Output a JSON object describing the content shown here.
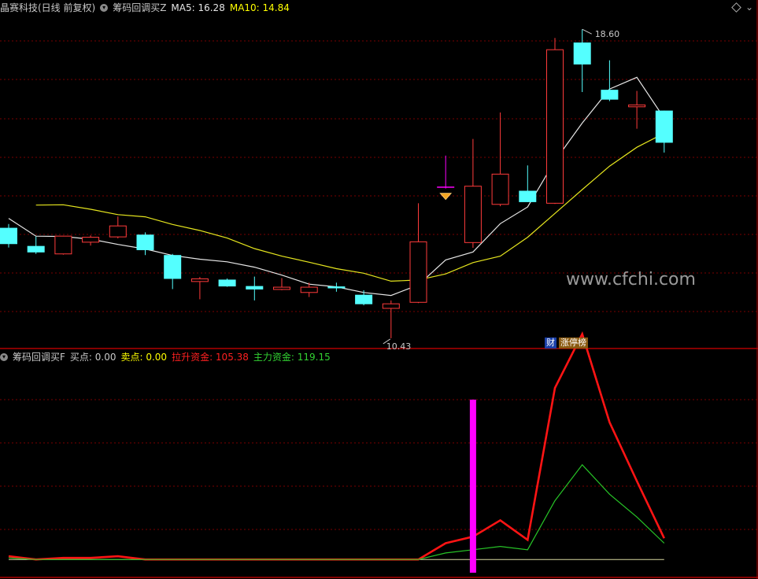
{
  "colors": {
    "background": "#000000",
    "frame": "#b00000",
    "grid": "#7a0000",
    "up_candle": "#ff3b3b",
    "down_candle": "#54ffff",
    "ma5": "#e6e6e6",
    "ma10": "#e6e61e",
    "signal_bar": "#ff00ff",
    "lashen": "#ff1414",
    "zhuli": "#27c527",
    "text_label": "#c8c8c8",
    "text_ma5": "#e6e6e6",
    "text_ma10": "#ffff00",
    "text_buy": "#c8c8c8",
    "text_sell": "#ffff00",
    "text_lashen": "#ff2020",
    "text_zhuli": "#32d232"
  },
  "header": {
    "stock": "晶赛科技(日线 前复权)",
    "indicator": "筹码回调买Z",
    "ma5_label": "MA5: 16.28",
    "ma10_label": "MA10: 14.84"
  },
  "sub_header": {
    "indicator": "筹码回调买F",
    "buy_label": "买点: 0.00",
    "sell_label": "卖点: 0.00",
    "lashen_label": "拉升资金: 105.38",
    "zhuli_label": "主力资金: 119.15"
  },
  "watermark": "www.cfchi.com",
  "badges": [
    "财",
    "涨停榜"
  ],
  "icons": [
    "circle-arrow-icon",
    "diamond-icon",
    "caret-icon",
    "gem-icon"
  ],
  "chart_data": [
    {
      "type": "candlestick",
      "title": "晶赛科技(日线 前复权)",
      "y_range": [
        10.2,
        19.0
      ],
      "candles": [
        {
          "open": 13.35,
          "high": 13.45,
          "low": 12.83,
          "close": 12.92
        },
        {
          "open": 12.87,
          "high": 13.12,
          "low": 12.66,
          "close": 12.7
        },
        {
          "open": 12.66,
          "high": 13.14,
          "low": 12.64,
          "close": 13.13
        },
        {
          "open": 12.97,
          "high": 13.15,
          "low": 12.88,
          "close": 13.1
        },
        {
          "open": 13.11,
          "high": 13.65,
          "low": 13.07,
          "close": 13.4
        },
        {
          "open": 13.17,
          "high": 13.23,
          "low": 12.63,
          "close": 12.76
        },
        {
          "open": 12.63,
          "high": 12.66,
          "low": 11.73,
          "close": 12.0
        },
        {
          "open": 11.93,
          "high": 12.05,
          "low": 11.46,
          "close": 12.0
        },
        {
          "open": 11.98,
          "high": 12.01,
          "low": 11.79,
          "close": 11.8
        },
        {
          "open": 11.81,
          "high": 12.06,
          "low": 11.43,
          "close": 11.72
        },
        {
          "open": 11.72,
          "high": 12.02,
          "low": 11.7,
          "close": 11.78
        },
        {
          "open": 11.64,
          "high": 11.9,
          "low": 11.52,
          "close": 11.78
        },
        {
          "open": 11.8,
          "high": 11.9,
          "low": 11.66,
          "close": 11.75
        },
        {
          "open": 11.58,
          "high": 11.7,
          "low": 11.3,
          "close": 11.33
        },
        {
          "open": 11.22,
          "high": 11.43,
          "low": 10.43,
          "close": 11.34
        },
        {
          "open": 11.38,
          "high": 14.0,
          "low": 11.36,
          "close": 12.98
        },
        {
          "open": 14.44,
          "high": 15.26,
          "low": 14.39,
          "close": 14.43
        },
        {
          "open": 12.96,
          "high": 15.7,
          "low": 12.82,
          "close": 14.45
        },
        {
          "open": 13.97,
          "high": 16.4,
          "low": 13.92,
          "close": 14.77
        },
        {
          "open": 14.33,
          "high": 15.0,
          "low": 14.03,
          "close": 14.03
        },
        {
          "open": 14.0,
          "high": 18.37,
          "low": 13.98,
          "close": 18.06
        },
        {
          "open": 18.25,
          "high": 18.6,
          "low": 16.94,
          "close": 17.67
        },
        {
          "open": 17.0,
          "high": 17.78,
          "low": 16.7,
          "close": 16.74
        },
        {
          "open": 16.55,
          "high": 16.97,
          "low": 15.97,
          "close": 16.6
        },
        {
          "open": 16.45,
          "high": 16.45,
          "low": 15.34,
          "close": 15.6
        }
      ],
      "candle_colors": [
        "down",
        "down",
        "up",
        "up",
        "up",
        "down",
        "down",
        "up",
        "down",
        "down",
        "up",
        "up",
        "down",
        "down",
        "up",
        "up",
        "magenta",
        "up",
        "up",
        "down",
        "up",
        "down",
        "down",
        "up",
        "down"
      ],
      "ma5": [
        13.6,
        13.13,
        13.12,
        13.05,
        12.91,
        12.79,
        12.62,
        12.52,
        12.45,
        12.31,
        12.1,
        11.86,
        11.79,
        11.64,
        11.56,
        11.84,
        12.5,
        12.71,
        13.46,
        13.9,
        15.12,
        16.12,
        17.02,
        17.33,
        16.25
      ],
      "ma10": [
        null,
        13.95,
        13.96,
        13.84,
        13.7,
        13.64,
        13.44,
        13.28,
        13.08,
        12.8,
        12.6,
        12.44,
        12.27,
        12.15,
        11.94,
        11.97,
        12.13,
        12.43,
        12.6,
        13.1,
        13.73,
        14.36,
        14.98,
        15.48,
        15.85
      ],
      "min_label": "10.43",
      "max_label": "18.60"
    },
    {
      "type": "line",
      "title": "筹码回调买F",
      "y_range": [
        -10,
        120
      ],
      "series": [
        {
          "name": "拉升资金",
          "values": [
            2,
            0,
            1,
            1,
            2,
            0,
            0,
            0,
            0,
            0,
            0,
            0,
            0,
            0,
            0,
            0,
            10,
            14,
            24,
            12,
            105,
            138,
            84,
            48,
            13
          ]
        },
        {
          "name": "主力资金",
          "values": [
            1,
            0,
            0,
            0,
            0,
            0,
            0,
            0,
            0,
            0,
            0,
            0,
            0,
            0,
            0,
            0,
            4,
            6,
            8,
            6,
            36,
            58,
            40,
            26,
            10
          ]
        }
      ],
      "buy_signal_index": 17
    }
  ]
}
